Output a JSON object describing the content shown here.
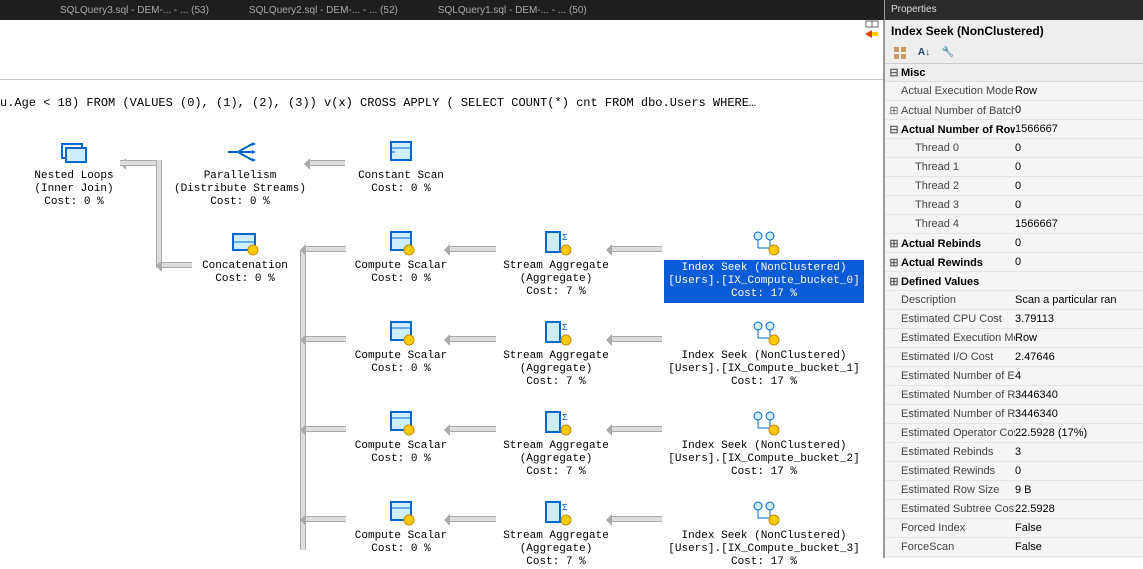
{
  "tabs": [
    "SQLQuery3.sql - DEM-... - ... (53)",
    "SQLQuery2.sql - DEM-... - ... (52)",
    "SQLQuery1.sql - DEM-... - ... (50)"
  ],
  "sql": "u.Age < 18)  FROM (VALUES (0), (1), (2), (3)) v(x) CROSS APPLY ( SELECT COUNT(*) cnt FROM dbo.Users WHERE…",
  "nodes": {
    "nested": {
      "l1": "Nested Loops",
      "l2": "(Inner Join)",
      "l3": "Cost: 0 %"
    },
    "para": {
      "l1": "Parallelism",
      "l2": "(Distribute Streams)",
      "l3": "Cost: 0 %"
    },
    "const": {
      "l1": "Constant Scan",
      "l2": "Cost: 0 %"
    },
    "concat": {
      "l1": "Concatenation",
      "l2": "Cost: 0 %"
    },
    "cs1": {
      "l1": "Compute Scalar",
      "l2": "Cost: 0 %"
    },
    "cs2": {
      "l1": "Compute Scalar",
      "l2": "Cost: 0 %"
    },
    "cs3": {
      "l1": "Compute Scalar",
      "l2": "Cost: 0 %"
    },
    "cs4": {
      "l1": "Compute Scalar",
      "l2": "Cost: 0 %"
    },
    "sa1": {
      "l1": "Stream Aggregate",
      "l2": "(Aggregate)",
      "l3": "Cost: 7 %"
    },
    "sa2": {
      "l1": "Stream Aggregate",
      "l2": "(Aggregate)",
      "l3": "Cost: 7 %"
    },
    "sa3": {
      "l1": "Stream Aggregate",
      "l2": "(Aggregate)",
      "l3": "Cost: 7 %"
    },
    "sa4": {
      "l1": "Stream Aggregate",
      "l2": "(Aggregate)",
      "l3": "Cost: 7 %"
    },
    "ix0": {
      "l1": "Index Seek (NonClustered)",
      "l2": "[Users].[IX_Compute_bucket_0]",
      "l3": "Cost: 17 %"
    },
    "ix1": {
      "l1": "Index Seek (NonClustered)",
      "l2": "[Users].[IX_Compute_bucket_1]",
      "l3": "Cost: 17 %"
    },
    "ix2": {
      "l1": "Index Seek (NonClustered)",
      "l2": "[Users].[IX_Compute_bucket_2]",
      "l3": "Cost: 17 %"
    },
    "ix3": {
      "l1": "Index Seek (NonClustered)",
      "l2": "[Users].[IX_Compute_bucket_3]",
      "l3": "Cost: 17 %"
    }
  },
  "props": {
    "header": "Properties",
    "title": "Index Seek (NonClustered)",
    "category": "Misc",
    "rows": [
      {
        "k": "Actual Execution Mode",
        "v": "Row"
      },
      {
        "k": "Actual Number of Batches",
        "v": "0",
        "exp": "+"
      },
      {
        "k": "Actual Number of Rows",
        "v": "1566667",
        "exp": "-",
        "bold": true
      },
      {
        "k": "Thread 0",
        "v": "0",
        "child": true
      },
      {
        "k": "Thread 1",
        "v": "0",
        "child": true
      },
      {
        "k": "Thread 2",
        "v": "0",
        "child": true
      },
      {
        "k": "Thread 3",
        "v": "0",
        "child": true
      },
      {
        "k": "Thread 4",
        "v": "1566667",
        "child": true
      },
      {
        "k": "Actual Rebinds",
        "v": "0",
        "exp": "+",
        "bold": true
      },
      {
        "k": "Actual Rewinds",
        "v": "0",
        "exp": "+",
        "bold": true
      },
      {
        "k": "Defined Values",
        "v": "",
        "exp": "+",
        "bold": true
      },
      {
        "k": "Description",
        "v": "Scan a particular ran"
      },
      {
        "k": "Estimated CPU Cost",
        "v": "3.79113"
      },
      {
        "k": "Estimated Execution Mode",
        "v": "Row"
      },
      {
        "k": "Estimated I/O Cost",
        "v": "2.47646"
      },
      {
        "k": "Estimated Number of Executions",
        "v": "4"
      },
      {
        "k": "Estimated Number of Rows",
        "v": "3446340"
      },
      {
        "k": "Estimated Number of Rows",
        "v": "3446340"
      },
      {
        "k": "Estimated Operator Cost",
        "v": "22.5928 (17%)"
      },
      {
        "k": "Estimated Rebinds",
        "v": "3"
      },
      {
        "k": "Estimated Rewinds",
        "v": "0"
      },
      {
        "k": "Estimated Row Size",
        "v": "9 B"
      },
      {
        "k": "Estimated Subtree Cost",
        "v": "22.5928"
      },
      {
        "k": "Forced Index",
        "v": "False"
      },
      {
        "k": "ForceScan",
        "v": "False"
      }
    ]
  }
}
